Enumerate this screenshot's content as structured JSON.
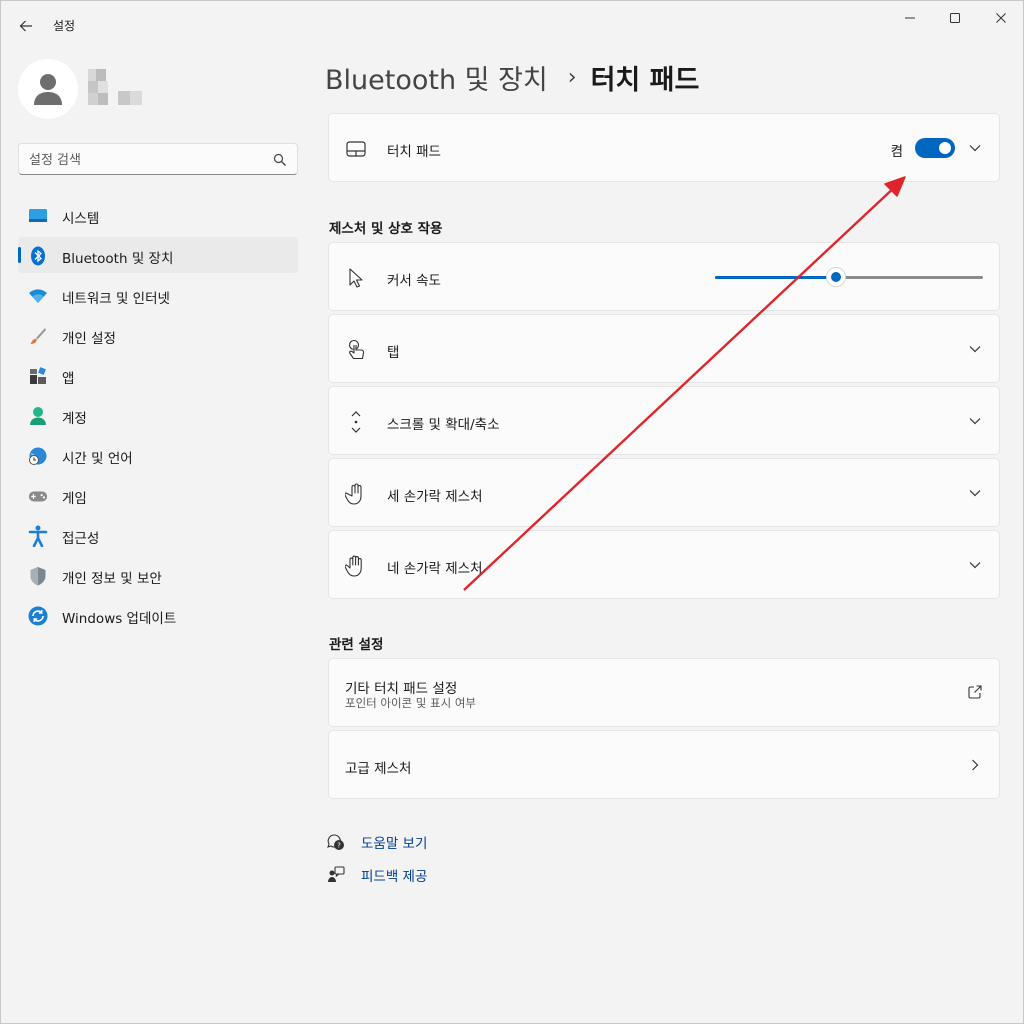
{
  "window": {
    "title": "설정"
  },
  "profile": {
    "name_redacted": true
  },
  "search": {
    "placeholder": "설정 검색"
  },
  "sidebar": {
    "items": [
      {
        "label": "시스템",
        "icon": "system-icon"
      },
      {
        "label": "Bluetooth 및 장치",
        "icon": "bluetooth-icon",
        "selected": true
      },
      {
        "label": "네트워크 및 인터넷",
        "icon": "wifi-icon"
      },
      {
        "label": "개인 설정",
        "icon": "brush-icon"
      },
      {
        "label": "앱",
        "icon": "apps-icon"
      },
      {
        "label": "계정",
        "icon": "account-icon"
      },
      {
        "label": "시간 및 언어",
        "icon": "globe-clock-icon"
      },
      {
        "label": "게임",
        "icon": "gamepad-icon"
      },
      {
        "label": "접근성",
        "icon": "accessibility-icon"
      },
      {
        "label": "개인 정보 및 보안",
        "icon": "shield-icon"
      },
      {
        "label": "Windows 업데이트",
        "icon": "update-icon"
      }
    ]
  },
  "breadcrumb": {
    "parent": "Bluetooth 및 장치",
    "separator": "›",
    "current": "터치 패드"
  },
  "touchpad_card": {
    "label": "터치 패드",
    "state_label": "켬",
    "enabled": true
  },
  "gestures": {
    "section_title": "제스처 및 상호 작용",
    "cursor_speed": {
      "label": "커서 속도",
      "value_fraction": 0.45
    },
    "items": [
      {
        "label": "탭",
        "icon": "tap-icon"
      },
      {
        "label": "스크롤 및 확대/축소",
        "icon": "scroll-icon"
      },
      {
        "label": "세 손가락 제스처",
        "icon": "three-finger-icon"
      },
      {
        "label": "네 손가락 제스처",
        "icon": "four-finger-icon"
      }
    ]
  },
  "related": {
    "section_title": "관련 설정",
    "more_settings": {
      "title": "기타 터치 패드 설정",
      "subtitle": "포인터 아이콘 및 표시 여부"
    },
    "advanced": {
      "title": "고급 제스처"
    }
  },
  "links": {
    "help": "도움말 보기",
    "feedback": "피드백 제공"
  },
  "colors": {
    "accent": "#0067c0",
    "annotation_arrow": "#e0242b"
  }
}
